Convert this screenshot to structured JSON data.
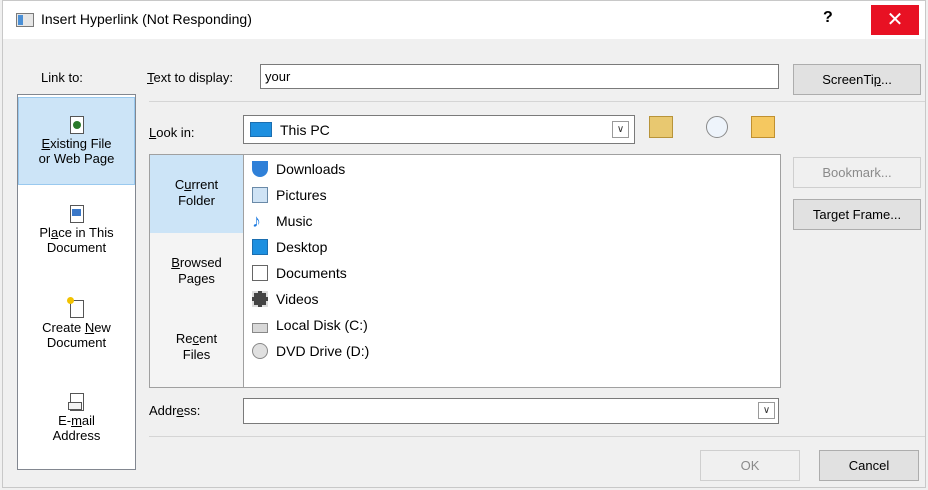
{
  "window": {
    "title": "Insert Hyperlink (Not Responding)",
    "help_label": "?",
    "close_label": "✕"
  },
  "link_to": {
    "label": "Link to:",
    "items": [
      {
        "line1_u": "E",
        "line1_rest": "xisting File",
        "line2": "or Web Page"
      },
      {
        "line1_pre": "Pl",
        "line1_u": "a",
        "line1_rest": "ce in This",
        "line2": "Document"
      },
      {
        "line1_pre": "Create ",
        "line1_u": "N",
        "line1_rest": "ew",
        "line2": "Document"
      },
      {
        "line1": "E-",
        "line1_u": "m",
        "line1_rest": "ail",
        "line2": "Address"
      }
    ]
  },
  "text_to_display": {
    "label_u": "T",
    "label_rest": "ext to display:",
    "value": "your"
  },
  "look_in": {
    "label_u": "L",
    "label_rest": "ook in:",
    "value": "This PC"
  },
  "places": [
    {
      "line1_pre": "C",
      "line1_u": "u",
      "line1_rest": "rrent",
      "line2": "Folder"
    },
    {
      "line1_u": "B",
      "line1_rest": "rowsed",
      "line2": "Pages"
    },
    {
      "line1_pre": "Re",
      "line1_u": "c",
      "line1_rest": "ent",
      "line2": "Files"
    }
  ],
  "files": [
    "Downloads",
    "Pictures",
    "Music",
    "Desktop",
    "Documents",
    "Videos",
    "Local Disk (C:)",
    "DVD Drive (D:)"
  ],
  "address": {
    "label_pre": "Addr",
    "label_u": "e",
    "label_rest": "ss:",
    "value": ""
  },
  "buttons": {
    "screentip_pre": "ScreenTi",
    "screentip_u": "p",
    "screentip_rest": "...",
    "bookmark": "Bookmark...",
    "target_pre": "Tar",
    "target_u": "g",
    "target_rest": "et Frame...",
    "ok": "OK",
    "cancel": "Cancel"
  }
}
